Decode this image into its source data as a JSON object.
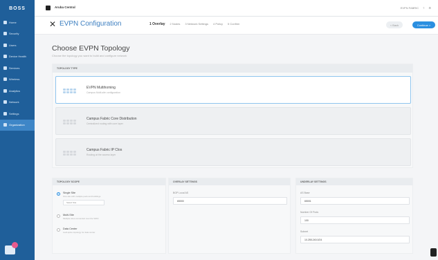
{
  "sidebar": {
    "logo": "BOSS",
    "items": [
      {
        "label": "Home"
      },
      {
        "label": "Security"
      },
      {
        "label": "Users"
      },
      {
        "label": "Device Health"
      },
      {
        "label": "Services"
      },
      {
        "label": "Wireless"
      },
      {
        "label": "Analytics"
      },
      {
        "label": "Network"
      },
      {
        "label": "Settings"
      },
      {
        "label": "Organization"
      }
    ]
  },
  "topbar": {
    "app_name": "Aruba Central",
    "right_items": [
      "EVPN FABRIC",
      "?",
      "⚙"
    ]
  },
  "header": {
    "title": "EVPN Configuration",
    "steps": [
      "1 Overlay",
      "2 Nodes",
      "3 Network Settings",
      "4 Policy",
      "5 Confirm"
    ],
    "active_step_index": 0,
    "back_label": "< Back",
    "continue_label": "Continue >"
  },
  "page": {
    "title": "Choose EVPN Topology",
    "subtitle": "Choose the topology you want to build and configure network"
  },
  "topology_panel": {
    "header": "TOPOLOGY TYPE",
    "options": [
      {
        "name": "EVPN Multihoming",
        "desc": "Campus Multi-site configuration"
      },
      {
        "name": "Campus Fabric Core Distribution",
        "desc": "Centralized routing with core layer"
      },
      {
        "name": "Campus Fabric IP Clos",
        "desc": "Routing at the access layer"
      }
    ],
    "selected_index": 0
  },
  "topology_scope": {
    "header": "TOPOLOGY SCOPE",
    "options": [
      {
        "label": "Single Site",
        "desc": "One site with multiple pods and buildings",
        "select_label": "Select Site"
      },
      {
        "label": "Multi-Site",
        "desc": "Multiple sites connected over the WAN"
      },
      {
        "label": "Data Center",
        "desc": "Leaf-spine topology for data center"
      }
    ],
    "selected_index": 0
  },
  "overlay_settings": {
    "header": "OVERLAY SETTINGS",
    "field_label": "BGP Local AS",
    "field_value": "65000"
  },
  "underlay_settings": {
    "header": "UNDERLAY SETTINGS",
    "fields": [
      {
        "label": "AS Base",
        "value": "65001"
      },
      {
        "label": "Number Of Pods",
        "value": "100"
      },
      {
        "label": "Subnet",
        "value": "10.255.240.0/24"
      }
    ]
  }
}
